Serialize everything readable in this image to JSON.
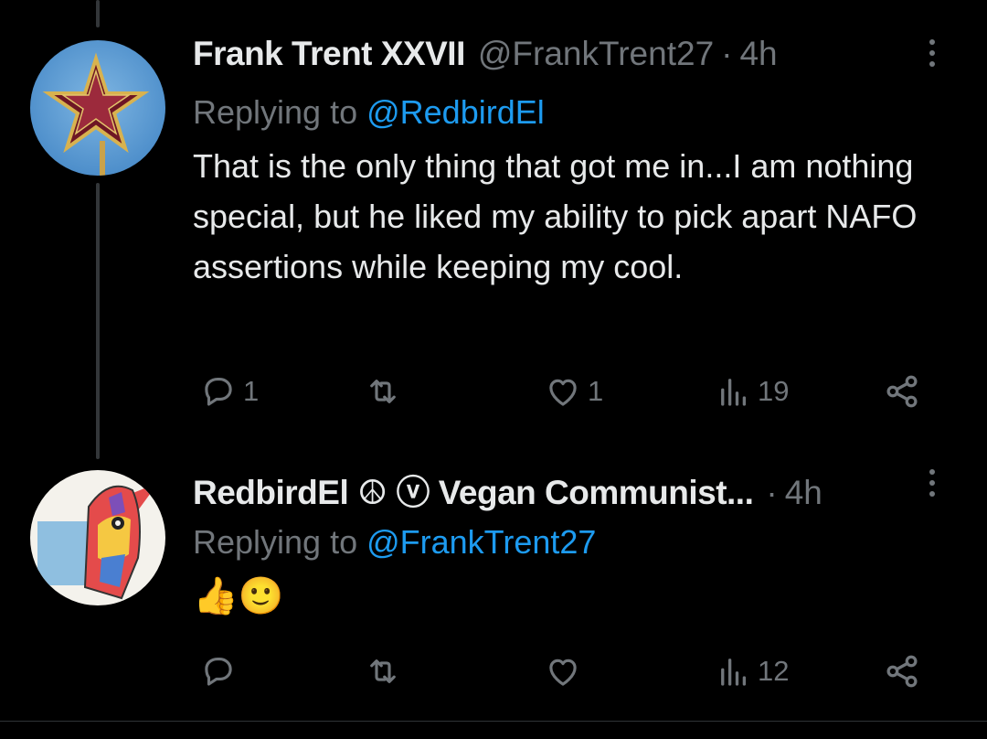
{
  "tweets": [
    {
      "display_name": "Frank Trent XXVII",
      "handle": "@FrankTrent27",
      "separator": "·",
      "time": "4h",
      "replying_prefix": "Replying to ",
      "replying_to": "@RedbirdEl",
      "text": "That is the only thing that got me in...I am nothing special, but he liked my ability to pick apart NAFO assertions while keeping my cool.",
      "avatar_icon": "red-star-icon",
      "reply_count": "1",
      "retweet_count": "",
      "like_count": "1",
      "view_count": "19"
    },
    {
      "display_name": "RedbirdEl ☮ ⓥ Vegan Communist...",
      "handle": "",
      "separator": "·",
      "time": "4h",
      "replying_prefix": "Replying to ",
      "replying_to": "@FrankTrent27",
      "text": "👍🙂",
      "avatar_icon": "bird-drawing-icon",
      "reply_count": "",
      "retweet_count": "",
      "like_count": "",
      "view_count": "12"
    }
  ],
  "colors": {
    "background": "#000000",
    "text": "#e7e9ea",
    "muted": "#71767b",
    "link": "#1d9bf0",
    "thread_line": "#333639"
  }
}
